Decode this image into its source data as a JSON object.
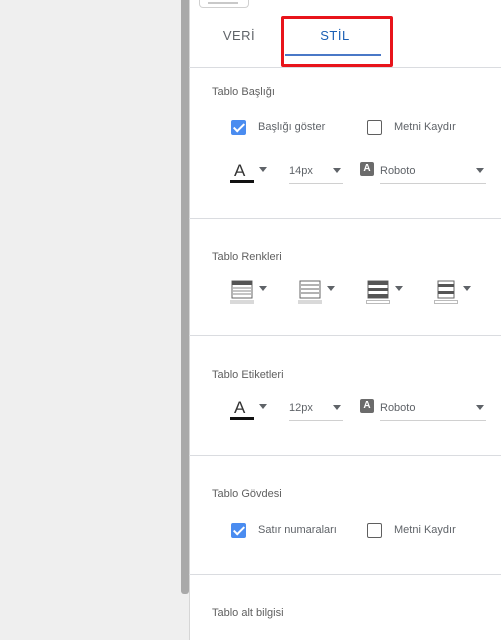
{
  "tabs": {
    "data": "VERİ",
    "style": "STİL"
  },
  "table_header": {
    "title": "Tablo Başlığı",
    "show_header": {
      "label": "Başlığı göster",
      "checked": true
    },
    "wrap_text": {
      "label": "Metni Kaydır",
      "checked": false
    },
    "font_size": "14px",
    "font_family": "Roboto",
    "font_icon": "A"
  },
  "table_colors": {
    "title": "Tablo Renkleri",
    "icons": [
      "header-background-icon",
      "cell-border-icon",
      "odd-row-color-icon",
      "even-row-color-icon"
    ]
  },
  "table_labels": {
    "title": "Tablo Etiketleri",
    "font_size": "12px",
    "font_family": "Roboto",
    "font_icon": "A"
  },
  "table_body": {
    "title": "Tablo Gövdesi",
    "row_numbers": {
      "label": "Satır numaraları",
      "checked": true
    },
    "wrap_text": {
      "label": "Metni Kaydır",
      "checked": false
    }
  },
  "table_footer": {
    "title": "Tablo alt bilgisi"
  },
  "colors": {
    "accent": "#4a78c7",
    "checkbox_on": "#4a8cf0",
    "highlight": "#e8141b"
  }
}
